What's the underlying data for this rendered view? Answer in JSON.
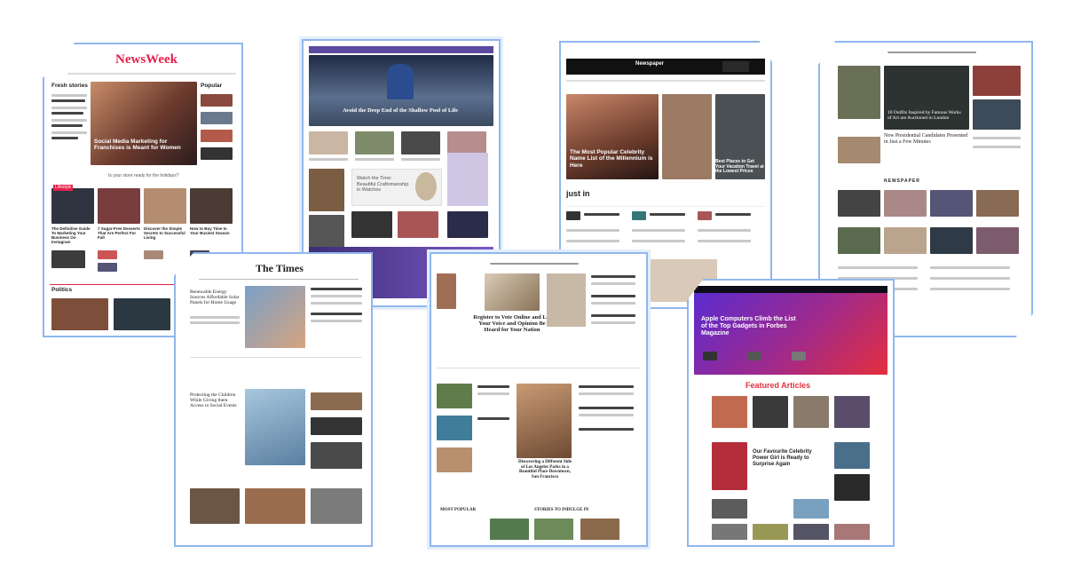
{
  "mockups": {
    "newsweek": {
      "logo": "NewsWeek",
      "fresh_stories": "Fresh stories",
      "popular": "Popular",
      "feature_headline": "Social Media Marketing for Franchises is Meant for Women",
      "politics": "Politics",
      "lifestyle_label": "Lifestyle",
      "sidebar_promo": "Is your store ready for the holidays?",
      "stories": [
        "The Definitive Guide To Marketing Your Business On Instagram",
        "7 Sugar-Free Desserts That Are Perfect For Fall",
        "Discover the Simple Secrets to Successful Living",
        "How to Buy Time In Your Busiest Season"
      ]
    },
    "travel": {
      "headline": "Avoid the Deep End of the Shallow Pool of Life",
      "mid_title": "Watch the Time: Beautiful Craftsmanship in Watches"
    },
    "newspaper": {
      "logo": "Newspaper",
      "feature_headline": "The Most Popular Celebrity Name List of the Millennium is Here",
      "side_story": "Best Places to Get Your Vacation Travel at the Lowest Prices",
      "just_in": "just in"
    },
    "columnist": {
      "headline_1": "10 Outfits Inspired by Famous Works of Art are Auctioned in London",
      "headline_2": "New Presidential Candidates Presented in Just a Few Minutes",
      "section": "NEWSPAPER"
    },
    "the_times": {
      "logo": "The Times",
      "lead": "Renewable Energy Sources Affordable Solar Panels for Home Usage",
      "mid": "Protecting the Children While Giving them Access to Social Events"
    },
    "classic": {
      "headline": "Register to Vote Online and Let Your Voice and Opinion Be Heard for Your Nation",
      "side": "Discovering a Different Side of Los Angeles Parks in a Beautiful Place Downtown, San Francisco",
      "section_1": "MOST POPULAR",
      "section_2": "STORIES TO INDULGE IN"
    },
    "tech": {
      "feature_headline": "Apple Computers Climb the List of the Top Gadgets in Forbes Magazine",
      "featured_articles": "Featured Articles",
      "card_headline": "Our Favourite Celebrity Power Girl is Ready to Surprise Again"
    }
  },
  "colors": {
    "frame_border": "#8fb7ee",
    "newsweek_red": "#e5204a",
    "tech_purple": "#5b2bd0",
    "tech_red": "#e42f3d"
  }
}
